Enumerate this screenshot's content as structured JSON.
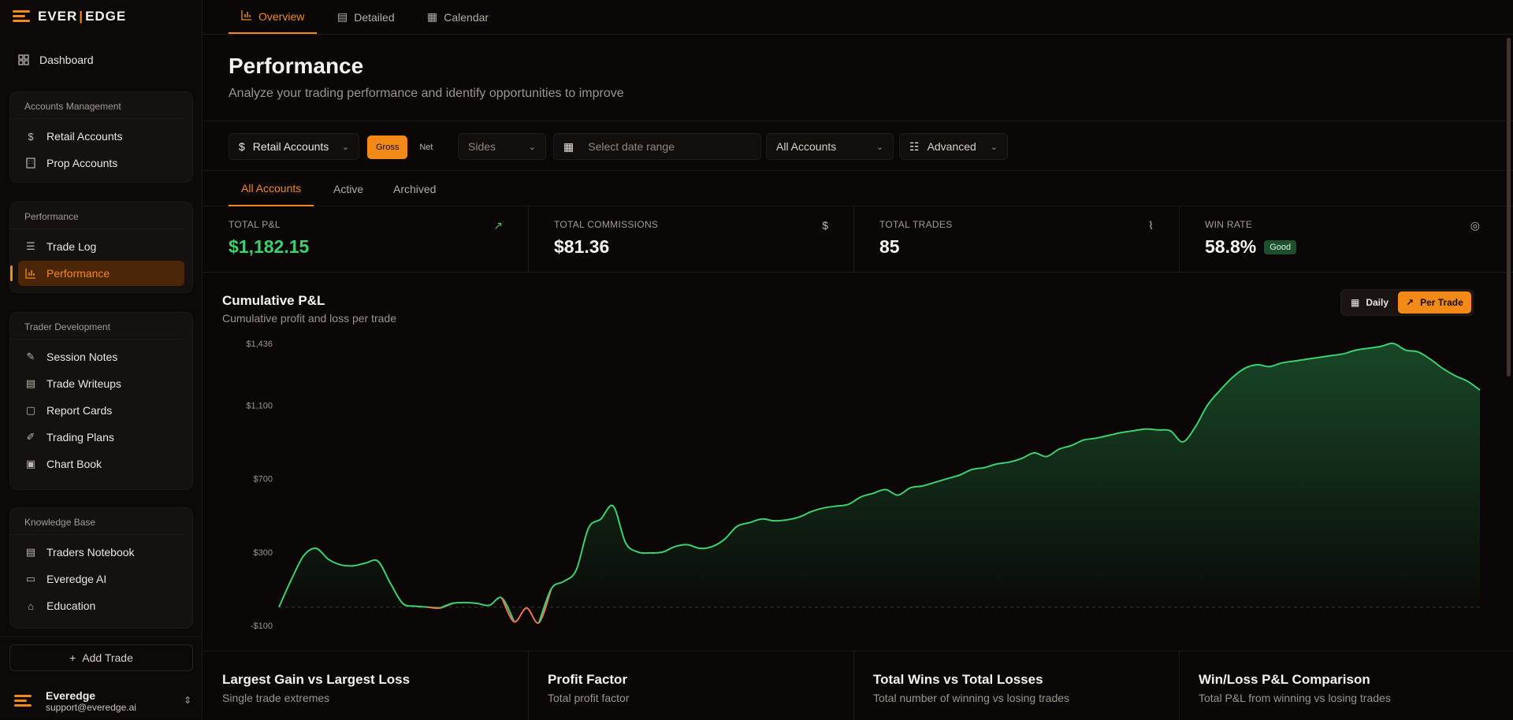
{
  "brand": {
    "logo_text_left": "EVER",
    "logo_text_right": "EDGE",
    "accent": "#f28a1a"
  },
  "sidebar": {
    "dashboard": "Dashboard",
    "groups": [
      {
        "title": "Accounts Management",
        "items": [
          {
            "label": "Retail Accounts",
            "icon": "dollar-icon"
          },
          {
            "label": "Prop Accounts",
            "icon": "building-icon"
          }
        ]
      },
      {
        "title": "Performance",
        "items": [
          {
            "label": "Trade Log",
            "icon": "list-icon"
          },
          {
            "label": "Performance",
            "icon": "bar-chart-icon",
            "active": true
          }
        ]
      },
      {
        "title": "Trader Development",
        "items": [
          {
            "label": "Session Notes",
            "icon": "edit-note-icon"
          },
          {
            "label": "Trade Writeups",
            "icon": "document-icon"
          },
          {
            "label": "Report Cards",
            "icon": "report-card-icon"
          },
          {
            "label": "Trading Plans",
            "icon": "pencil-square-icon"
          },
          {
            "label": "Chart Book",
            "icon": "image-icon"
          }
        ]
      },
      {
        "title": "Knowledge Base",
        "items": [
          {
            "label": "Traders Notebook",
            "icon": "notebook-icon"
          },
          {
            "label": "Everedge AI",
            "icon": "chat-icon"
          },
          {
            "label": "Education",
            "icon": "graduation-cap-icon"
          }
        ]
      }
    ],
    "add_trade": "Add Trade",
    "user": {
      "name": "Everedge",
      "email": "support@everedge.ai"
    }
  },
  "top_tabs": [
    {
      "label": "Overview",
      "active": true
    },
    {
      "label": "Detailed"
    },
    {
      "label": "Calendar"
    }
  ],
  "page": {
    "title": "Performance",
    "subtitle": "Analyze your trading performance and identify opportunities to improve"
  },
  "filters": {
    "account_type": "Retail Accounts",
    "gross": "Gross",
    "net": "Net",
    "sides_placeholder": "Sides",
    "date_placeholder": "Select date range",
    "accounts": "All Accounts",
    "advanced": "Advanced"
  },
  "sub_tabs": [
    {
      "label": "All Accounts",
      "active": true
    },
    {
      "label": "Active"
    },
    {
      "label": "Archived"
    }
  ],
  "stats": [
    {
      "label": "TOTAL P&L",
      "value": "$1,182.15",
      "icon": "trending-up-icon"
    },
    {
      "label": "TOTAL COMMISSIONS",
      "value": "$81.36",
      "icon": "dollar-icon"
    },
    {
      "label": "TOTAL TRADES",
      "value": "85",
      "icon": "activity-icon"
    },
    {
      "label": "WIN RATE",
      "value": "58.8%",
      "badge": "Good",
      "icon": "target-icon"
    }
  ],
  "chart_section": {
    "title": "Cumulative P&L",
    "subtitle": "Cumulative profit and loss per trade",
    "toggle_daily": "Daily",
    "toggle_per_trade": "Per Trade"
  },
  "chart_data": {
    "type": "area",
    "title": "Cumulative P&L",
    "xlabel": "",
    "ylabel": "",
    "ylim": [
      -100,
      1436
    ],
    "yticks": [
      "$1,436",
      "$1,100",
      "$700",
      "$300",
      "-$100"
    ],
    "ytick_values": [
      1436,
      1100,
      700,
      300,
      -100
    ],
    "grid": false,
    "colors": {
      "positive": "#3ecf6e",
      "negative": "#e8735a"
    },
    "series": [
      {
        "values": [
          0,
          150,
          280,
          320,
          260,
          230,
          225,
          240,
          250,
          130,
          20,
          5,
          0,
          -5,
          20,
          25,
          20,
          10,
          50,
          -80,
          -5,
          -85,
          100,
          140,
          200,
          430,
          480,
          550,
          350,
          300,
          295,
          300,
          330,
          340,
          320,
          330,
          370,
          440,
          460,
          480,
          470,
          475,
          490,
          520,
          540,
          550,
          560,
          600,
          620,
          640,
          610,
          650,
          660,
          680,
          700,
          720,
          750,
          760,
          780,
          790,
          810,
          840,
          820,
          860,
          880,
          910,
          920,
          935,
          950,
          960,
          970,
          965,
          960,
          900,
          980,
          1100,
          1180,
          1250,
          1300,
          1320,
          1310,
          1330,
          1340,
          1350,
          1360,
          1370,
          1380,
          1400,
          1410,
          1420,
          1436,
          1400,
          1390,
          1350,
          1300,
          1260,
          1230,
          1182
        ]
      }
    ]
  },
  "bottom_cards": [
    {
      "title": "Largest Gain vs Largest Loss",
      "subtitle": "Single trade extremes"
    },
    {
      "title": "Profit Factor",
      "subtitle": "Total profit factor"
    },
    {
      "title": "Total Wins vs Total Losses",
      "subtitle": "Total number of winning vs losing trades"
    },
    {
      "title": "Win/Loss P&L Comparison",
      "subtitle": "Total P&L from winning vs losing trades"
    }
  ]
}
